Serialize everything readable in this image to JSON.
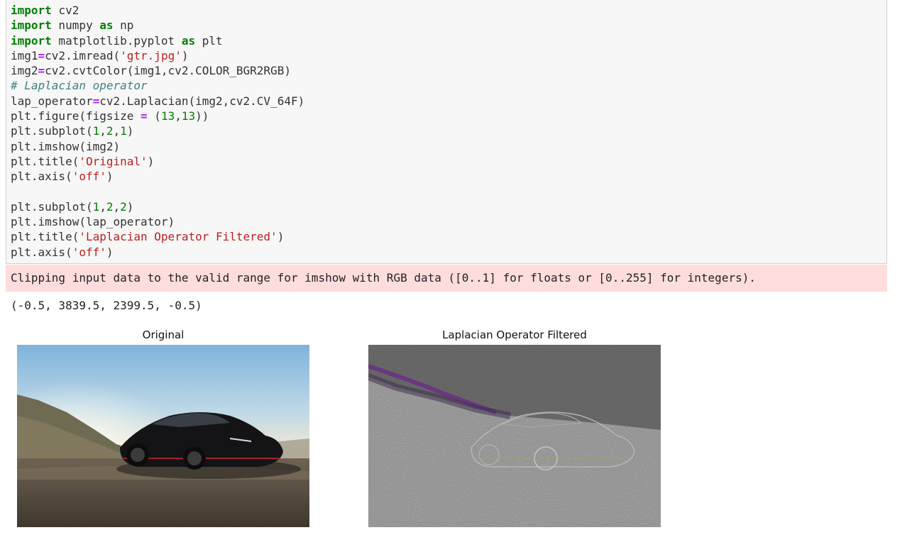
{
  "code": {
    "lines": [
      [
        {
          "t": "import",
          "c": "kw"
        },
        {
          "t": " cv2",
          "c": ""
        }
      ],
      [
        {
          "t": "import",
          "c": "kw"
        },
        {
          "t": " numpy ",
          "c": ""
        },
        {
          "t": "as",
          "c": "kw"
        },
        {
          "t": " np",
          "c": ""
        }
      ],
      [
        {
          "t": "import",
          "c": "kw"
        },
        {
          "t": " matplotlib.pyplot ",
          "c": ""
        },
        {
          "t": "as",
          "c": "kw"
        },
        {
          "t": " plt",
          "c": ""
        }
      ],
      [
        {
          "t": "img1",
          "c": ""
        },
        {
          "t": "=",
          "c": "op"
        },
        {
          "t": "cv2.imread(",
          "c": ""
        },
        {
          "t": "'gtr.jpg'",
          "c": "str"
        },
        {
          "t": ")",
          "c": ""
        }
      ],
      [
        {
          "t": "img2",
          "c": ""
        },
        {
          "t": "=",
          "c": "op"
        },
        {
          "t": "cv2.cvtColor(img1,cv2.COLOR_BGR2RGB)",
          "c": ""
        }
      ],
      [
        {
          "t": "# Laplacian operator",
          "c": "cmt"
        }
      ],
      [
        {
          "t": "lap_operator",
          "c": ""
        },
        {
          "t": "=",
          "c": "op"
        },
        {
          "t": "cv2.Laplacian(img2,cv2.CV_64F)",
          "c": ""
        }
      ],
      [
        {
          "t": "plt.figure(figsize ",
          "c": ""
        },
        {
          "t": "=",
          "c": "op"
        },
        {
          "t": " (",
          "c": ""
        },
        {
          "t": "13",
          "c": "num"
        },
        {
          "t": ",",
          "c": ""
        },
        {
          "t": "13",
          "c": "num"
        },
        {
          "t": "))",
          "c": ""
        }
      ],
      [
        {
          "t": "plt.subplot(",
          "c": ""
        },
        {
          "t": "1",
          "c": "num"
        },
        {
          "t": ",",
          "c": ""
        },
        {
          "t": "2",
          "c": "num"
        },
        {
          "t": ",",
          "c": ""
        },
        {
          "t": "1",
          "c": "num"
        },
        {
          "t": ")",
          "c": ""
        }
      ],
      [
        {
          "t": "plt.imshow(img2)",
          "c": ""
        }
      ],
      [
        {
          "t": "plt.title(",
          "c": ""
        },
        {
          "t": "'Original'",
          "c": "str"
        },
        {
          "t": ")",
          "c": ""
        }
      ],
      [
        {
          "t": "plt.axis(",
          "c": ""
        },
        {
          "t": "'off'",
          "c": "str"
        },
        {
          "t": ")",
          "c": ""
        }
      ],
      [
        {
          "t": "",
          "c": ""
        }
      ],
      [
        {
          "t": "plt.subplot(",
          "c": ""
        },
        {
          "t": "1",
          "c": "num"
        },
        {
          "t": ",",
          "c": ""
        },
        {
          "t": "2",
          "c": "num"
        },
        {
          "t": ",",
          "c": ""
        },
        {
          "t": "2",
          "c": "num"
        },
        {
          "t": ")",
          "c": ""
        }
      ],
      [
        {
          "t": "plt.imshow(lap_operator)",
          "c": ""
        }
      ],
      [
        {
          "t": "plt.title(",
          "c": ""
        },
        {
          "t": "'Laplacian Operator Filtered'",
          "c": "str"
        },
        {
          "t": ")",
          "c": ""
        }
      ],
      [
        {
          "t": "plt.axis(",
          "c": ""
        },
        {
          "t": "'off'",
          "c": "str"
        },
        {
          "t": ")",
          "c": ""
        }
      ]
    ]
  },
  "output": {
    "stderr": "Clipping input data to the valid range for imshow with RGB data ([0..1] for floats or [0..255] for integers).",
    "result": "(-0.5, 3839.5, 2399.5, -0.5)"
  },
  "figures": {
    "left_title": "Original",
    "right_title": "Laplacian Operator Filtered"
  },
  "colors": {
    "cell_background": "#f7f7f7",
    "stderr_background": "#ffdddd",
    "keyword": "#008000",
    "string": "#ba2121",
    "comment": "#408080",
    "operator": "#aa22ff"
  }
}
